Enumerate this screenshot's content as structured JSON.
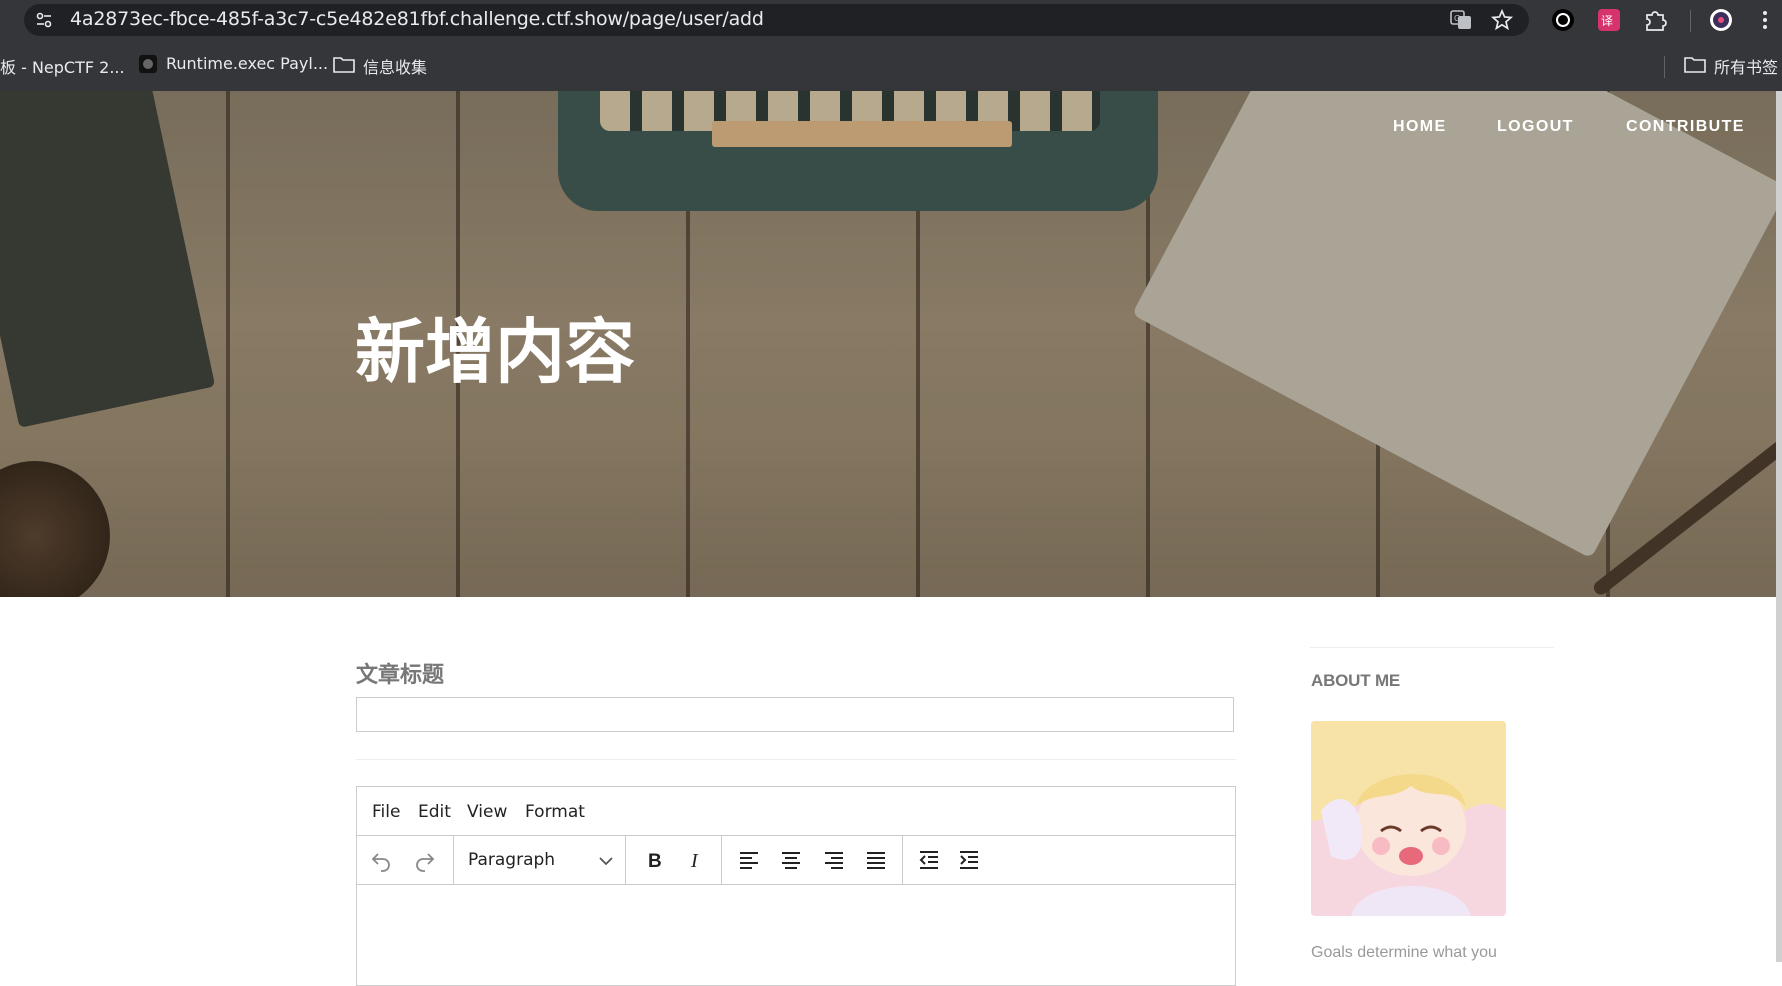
{
  "browser": {
    "url": "4a2873ec-fbce-485f-a3c7-c5e482e81fbf.challenge.ctf.show/page/user/add",
    "bookmarks": [
      {
        "label": "板 - NepCTF 2...",
        "icon": "page-icon"
      },
      {
        "label": "Runtime.exec Payl...",
        "icon": "site-favicon"
      },
      {
        "label": "信息收集",
        "icon": "folder-icon"
      }
    ],
    "all_bookmarks_label": "所有书签",
    "icons": [
      "site-info-icon",
      "translate-icon",
      "star-icon",
      "record-icon",
      "translate-extension-icon",
      "puzzle-icon",
      "profile-icon",
      "more-icon"
    ]
  },
  "nav": {
    "home": "HOME",
    "logout": "LOGOUT",
    "contribute": "CONTRIBUTE"
  },
  "hero": {
    "title": "新增内容"
  },
  "form": {
    "title_label": "文章标题",
    "title_value": "",
    "editor": {
      "menus": [
        "File",
        "Edit",
        "View",
        "Format"
      ],
      "block_format": "Paragraph",
      "tools": [
        "undo-icon",
        "redo-icon",
        "bold-icon",
        "italic-icon",
        "align-left-icon",
        "align-center-icon",
        "align-right-icon",
        "align-justify-icon",
        "outdent-icon",
        "indent-icon"
      ]
    }
  },
  "sidebar": {
    "about_heading": "ABOUT ME",
    "goals_text": "Goals determine what you"
  },
  "colors": {
    "chrome_bg": "#35363a",
    "omnibox_bg": "#202124",
    "text_muted": "#777777"
  }
}
